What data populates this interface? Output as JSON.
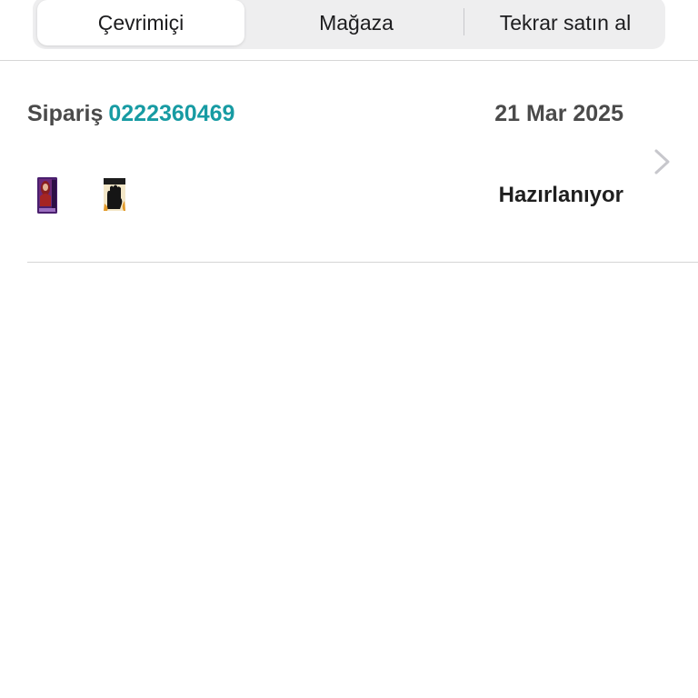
{
  "tabs": [
    {
      "label": "Çevrimiçi",
      "active": true
    },
    {
      "label": "Mağaza",
      "active": false
    },
    {
      "label": "Tekrar satın al",
      "active": false
    }
  ],
  "order": {
    "label": "Sipariş",
    "number": "0222360469",
    "date": "21 Mar 2025",
    "status": "Hazırlanıyor",
    "products": [
      {
        "icon": "hair-dye-box-icon"
      },
      {
        "icon": "black-glove-pack-icon"
      }
    ]
  },
  "colors": {
    "accent": "#179ba3",
    "segment_background": "#eeeeef",
    "divider": "#d6d6d6"
  }
}
